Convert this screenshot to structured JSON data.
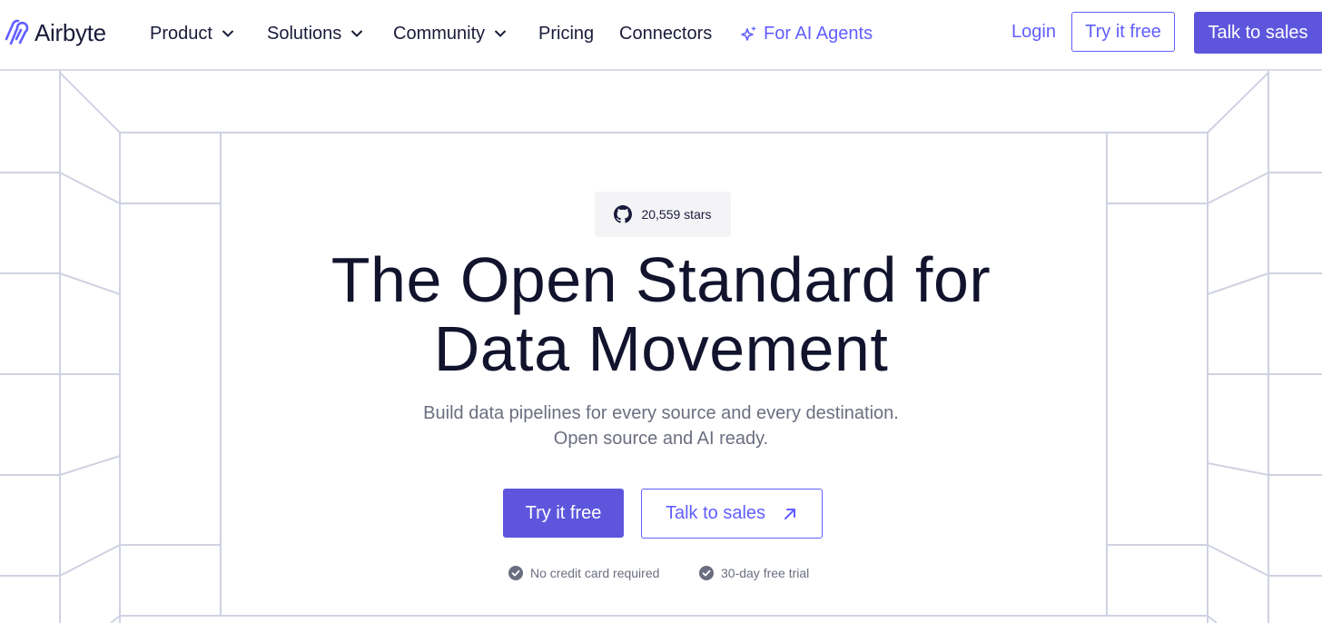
{
  "brand": {
    "name": "Airbyte"
  },
  "nav": {
    "items": [
      {
        "label": "Product",
        "has_dropdown": true
      },
      {
        "label": "Solutions",
        "has_dropdown": true
      },
      {
        "label": "Community",
        "has_dropdown": true
      },
      {
        "label": "Pricing",
        "has_dropdown": false
      },
      {
        "label": "Connectors",
        "has_dropdown": false
      }
    ],
    "ai_agents": {
      "label": "For AI Agents",
      "icon": "sparkle-icon"
    },
    "login_label": "Login",
    "try_label": "Try it free",
    "sales_label": "Talk to sales"
  },
  "hero": {
    "stars": {
      "icon": "github-icon",
      "label": "20,559 stars"
    },
    "title_line1": "The Open Standard for",
    "title_line2": "Data Movement",
    "subtitle_line1": "Build data pipelines for every source and every destination.",
    "subtitle_line2": "Open source and AI ready.",
    "cta_primary": "Try it free",
    "cta_secondary": "Talk to sales",
    "cta_secondary_icon": "arrow-up-right-icon",
    "perks": [
      {
        "icon": "check-circle-icon",
        "label": "No credit card required"
      },
      {
        "icon": "check-circle-icon",
        "label": "30-day free trial"
      }
    ]
  },
  "colors": {
    "accent": "#615eff",
    "accent_fill": "#5d56dd",
    "heading": "#12132d",
    "muted": "#6b6e80",
    "grid_line": "#cfd2e2"
  }
}
